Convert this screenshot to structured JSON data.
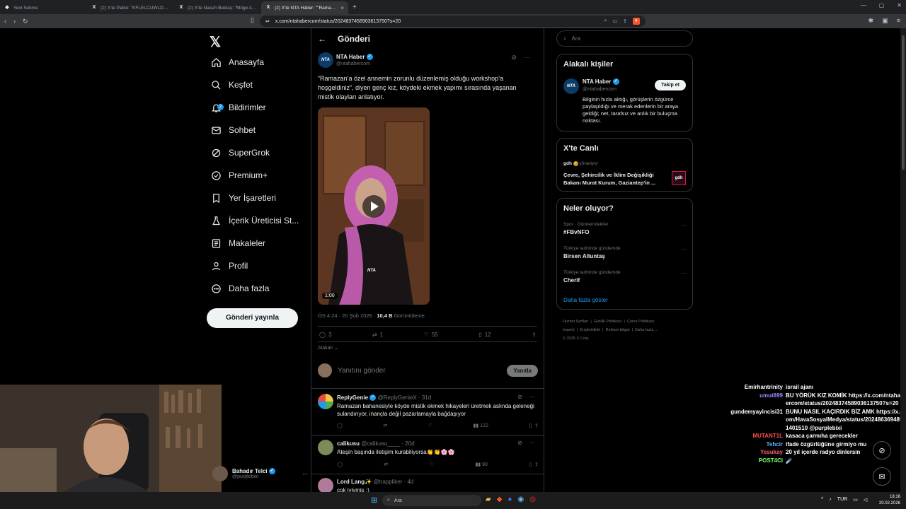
{
  "browser": {
    "tabs": [
      {
        "label": "Yeni Sekme",
        "icon": "brave-icon"
      },
      {
        "label": "(2) X'te Pablo: \"KFLELCUWLDLELCLE(",
        "icon": "x-icon"
      },
      {
        "label": "(2) X'te Nasuh Bektaş: \"Müge Anlı'nı",
        "icon": "x-icon"
      },
      {
        "label": "(2) X'te NTA Haber: \"\"Ramazan'a",
        "icon": "x-icon",
        "active": true
      }
    ],
    "url": "x.com/ntahabercom/status/2024837458903613750?s=20"
  },
  "sidebar": {
    "logo": "𝕏",
    "items": [
      {
        "label": "Anasayfa",
        "icon": "home-icon"
      },
      {
        "label": "Keşfet",
        "icon": "search-icon"
      },
      {
        "label": "Bildirimler",
        "icon": "bell-icon",
        "badge": "2"
      },
      {
        "label": "Sohbet",
        "icon": "mail-icon"
      },
      {
        "label": "SuperGrok",
        "icon": "grok-icon"
      },
      {
        "label": "Premium+",
        "icon": "premium-icon"
      },
      {
        "label": "Yer İşaretleri",
        "icon": "bookmark-icon"
      },
      {
        "label": "İçerik Üreticisi St...",
        "icon": "flask-icon"
      },
      {
        "label": "Makaleler",
        "icon": "article-icon"
      },
      {
        "label": "Profil",
        "icon": "person-icon"
      },
      {
        "label": "Daha fazla",
        "icon": "more-circle-icon"
      }
    ],
    "post_button": "Gönderi yayınla",
    "account": {
      "name": "Bahadır Telci",
      "handle": "@purplebixi"
    }
  },
  "main": {
    "header": "Gönderi",
    "tweet": {
      "name": "NTA Haber",
      "handle": "@ntahabercom",
      "avatar_text": "NTA",
      "text": "“Ramazan’a özel annemin zorunlu düzenlemiş olduğu workshop’a hoşgeldiniz”, diyen genç kız, köydeki ekmek yapımı sırasında yaşanan mistik olayları anlatıyor.",
      "video_duration": "1:00",
      "video_watermark": "NTA",
      "time": "ÖS 4:24 · 20 Şub 2026 · ",
      "views": "10,4 B",
      "views_label": " Görüntüleme",
      "replies": "3",
      "retweets": "1",
      "likes": "55",
      "bookmarks": "12"
    },
    "relevance": "Alakalı",
    "reply_placeholder": "Yanıtını gönder",
    "reply_button": "Yanıtla",
    "replies": [
      {
        "name": "ReplyGenie",
        "handle": "@ReplyGenieX · 31d",
        "text": "Ramazan bahanesiyle köyde mistik ekmek hikayeleri üretmek aslında geleneği sulandırıyor, inançla değil pazarlamayla bağdaşıyor",
        "views": "122",
        "color": "#f4c542"
      },
      {
        "name": "calikusu",
        "handle": "@calikusu____ · 20d",
        "text": "Ateşin başında iletişim kurabiliyorsa👏👏🌸🌸",
        "views": "90",
        "color": "#8a7a5a"
      },
      {
        "name": "Lord Lang✨",
        "handle": "@trappliker · 4d",
        "text": "çok iyiymiş :)",
        "views": "",
        "color": "#b07a9a"
      }
    ]
  },
  "right": {
    "search_placeholder": "Ara",
    "related_title": "Alakalı kişiler",
    "related": {
      "name": "NTA Haber",
      "handle": "@ntahabercom",
      "follow": "Takip et",
      "bio": "Bilginin hızla aktığı, görüşlerin özgürce paylaşıldığı ve merak edenlerin bir araya geldiği; net, tarafsız ve anlık bir buluşma noktası."
    },
    "live_title": "X'te Canlı",
    "live": {
      "host": "gdh",
      "host_role": "yönetiyor",
      "title": "Çevre, Şehircilik ve İklim Değişikliği Bakanı Murat Kurum, Gaziantep'in ...",
      "thumb": "gdh"
    },
    "trends_title": "Neler oluyor?",
    "trends": [
      {
        "category": "Spor · Gündemdekiler",
        "name": "#FBvNFO"
      },
      {
        "category": "Türkiye tarihinde gündemde",
        "name": "Birsen Altuntaş"
      },
      {
        "category": "Türkiye tarihinde gündemde",
        "name": "Cherif"
      }
    ],
    "show_more": "Daha fazla göster",
    "footer": {
      "links": [
        "Hizmet Şartları",
        "Gizlilik Politikası",
        "Çerez Politikası",
        "Imprint",
        "Erişilebilirlik",
        "Reklam bilgisi",
        "Daha fazla ..."
      ],
      "copyright": "© 2026 X Corp."
    }
  },
  "chat": [
    {
      "user": "Emirhantrinity",
      "color": "#ffffff",
      "text": "israil ajanı"
    },
    {
      "user": "umut899",
      "color": "#9b8cff",
      "text": "BU YÖRÜK KIZ KOMİK https://x.com/ntahabercom/status/2024837458903613750?s=20"
    },
    {
      "user": "gundemyayincisi31",
      "color": "#ffffff",
      "text": "BUNU NASIL KAÇIRDIK BİZ AMK https://x.com/HavaSosyalMedya/status/2024863694891401510 @purplebixi"
    },
    {
      "user": "MUTANT1L",
      "color": "#ff4a4a",
      "text": "kasaca çarmıha gerecekler"
    },
    {
      "user": "Tehcir",
      "color": "#58b6ff",
      "text": "ifade özgürlüğüne girmiyo mu"
    },
    {
      "user": "Yesukay",
      "color": "#ff5a7a",
      "text": "20 yıl içerde radyo dinlersin"
    },
    {
      "user": "POST4CI",
      "color": "#7dff6a",
      "text": "☄️"
    }
  ],
  "taskbar": {
    "search": "Ara",
    "lang": "TUR",
    "time": "18:16",
    "date": "20.02.2026"
  },
  "colors": {
    "accent": "#1d9bf0",
    "border": "#2f3336",
    "muted": "#71767b"
  }
}
